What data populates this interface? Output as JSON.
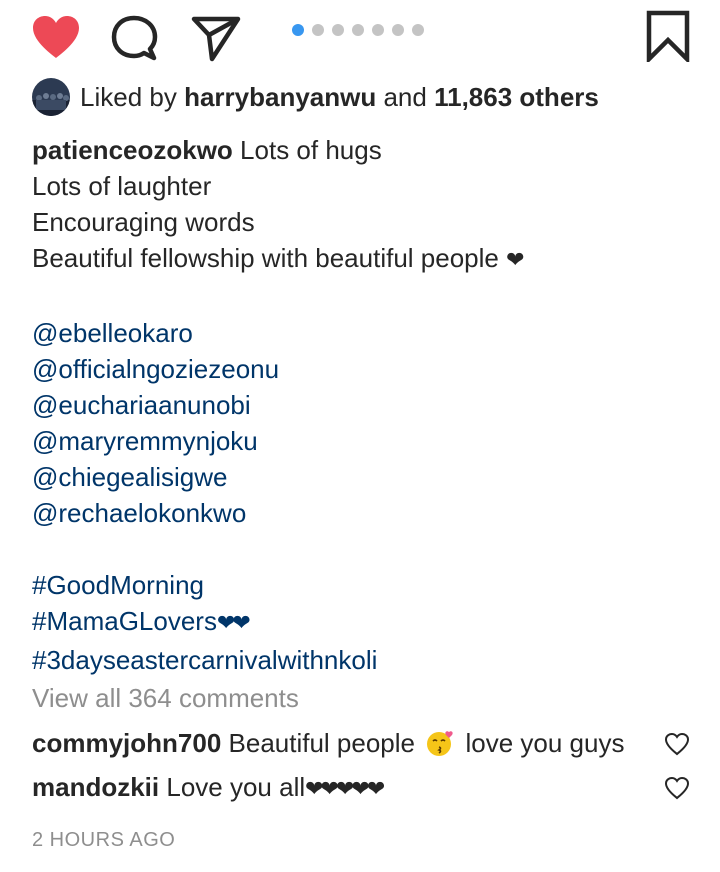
{
  "actions": {
    "like_icon": "heart-filled-icon",
    "comment_icon": "comment-icon",
    "share_icon": "paper-plane-icon",
    "save_icon": "bookmark-icon",
    "like_color": "#ed4956"
  },
  "carousel": {
    "total": 7,
    "active_index": 0,
    "active_color": "#3897f0",
    "inactive_color": "#c4c4c4"
  },
  "likes": {
    "prefix": "Liked by ",
    "user": "harrybanyanwu",
    "middle": " and ",
    "count_text": "11,863 others"
  },
  "caption": {
    "author": "patienceozokwo",
    "line1": " Lots of hugs",
    "line2": "Lots of laughter",
    "line3": "Encouraging words",
    "line4": "Beautiful fellowship with beautiful people ",
    "heart": "❤",
    "mentions": [
      "@ebelleokaro",
      "@officialngoziezeonu",
      "@euchariaanunobi",
      "@maryremmynjoku",
      "@chiegealisigwe",
      "@rechaelokonkwo"
    ],
    "hashtag1": "#GoodMorning",
    "hashtag2": "#MamaGLovers",
    "hashtag2_hearts": "❤❤",
    "hashtag3": "#3dayseastercarnivalwithnkoli"
  },
  "view_all_comments": "View all 364 comments",
  "comments": [
    {
      "user": "commyjohn700",
      "text_before": " Beautiful people ",
      "emoji": "kissing-face-emoji",
      "text_after": " love you guys"
    },
    {
      "user": "mandozkii",
      "text": " Love you all",
      "hearts": "❤❤❤❤❤"
    }
  ],
  "timestamp": "2 HOURS AGO",
  "colors": {
    "link": "#003569",
    "text": "#262626",
    "muted": "#8e8e8e"
  }
}
